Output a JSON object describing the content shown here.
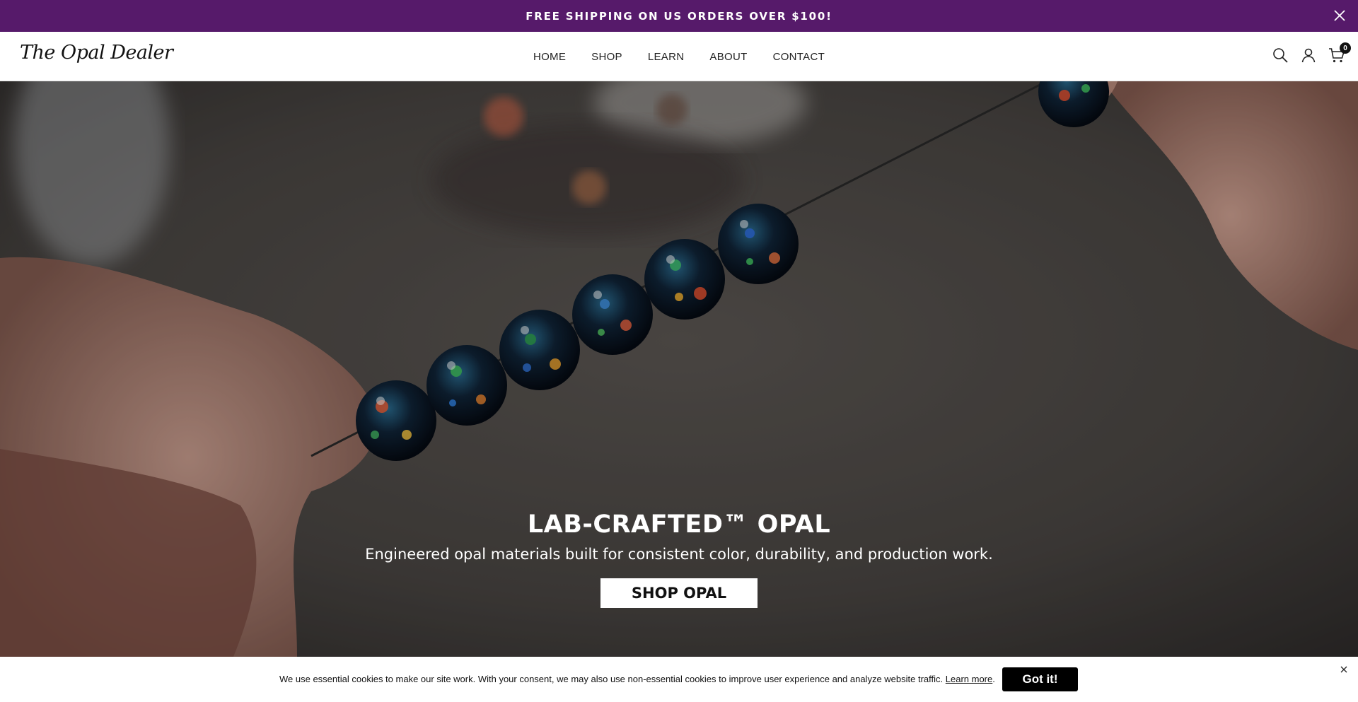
{
  "announcement": {
    "text": "FREE SHIPPING ON US ORDERS OVER $100!",
    "close_icon": "close-icon",
    "background": "#561a6a"
  },
  "header": {
    "logo": "The Opal Dealer",
    "nav": [
      "HOME",
      "SHOP",
      "LEARN",
      "ABOUT",
      "CONTACT"
    ],
    "icons": [
      "search-icon",
      "account-icon",
      "cart-icon"
    ],
    "cart_count": "0"
  },
  "hero": {
    "title": "LAB-CRAFTED™ OPAL",
    "subtitle": "Engineered opal materials built for consistent color, durability, and production work.",
    "cta": "SHOP OPAL"
  },
  "cookie_banner": {
    "message": "We use essential cookies to make our site work. With your consent, we may also use non-essential cookies to improve user experience and analyze website traffic.",
    "link": "Learn more",
    "after_link": ".",
    "button": "Got it!",
    "close_icon": "close-icon"
  }
}
